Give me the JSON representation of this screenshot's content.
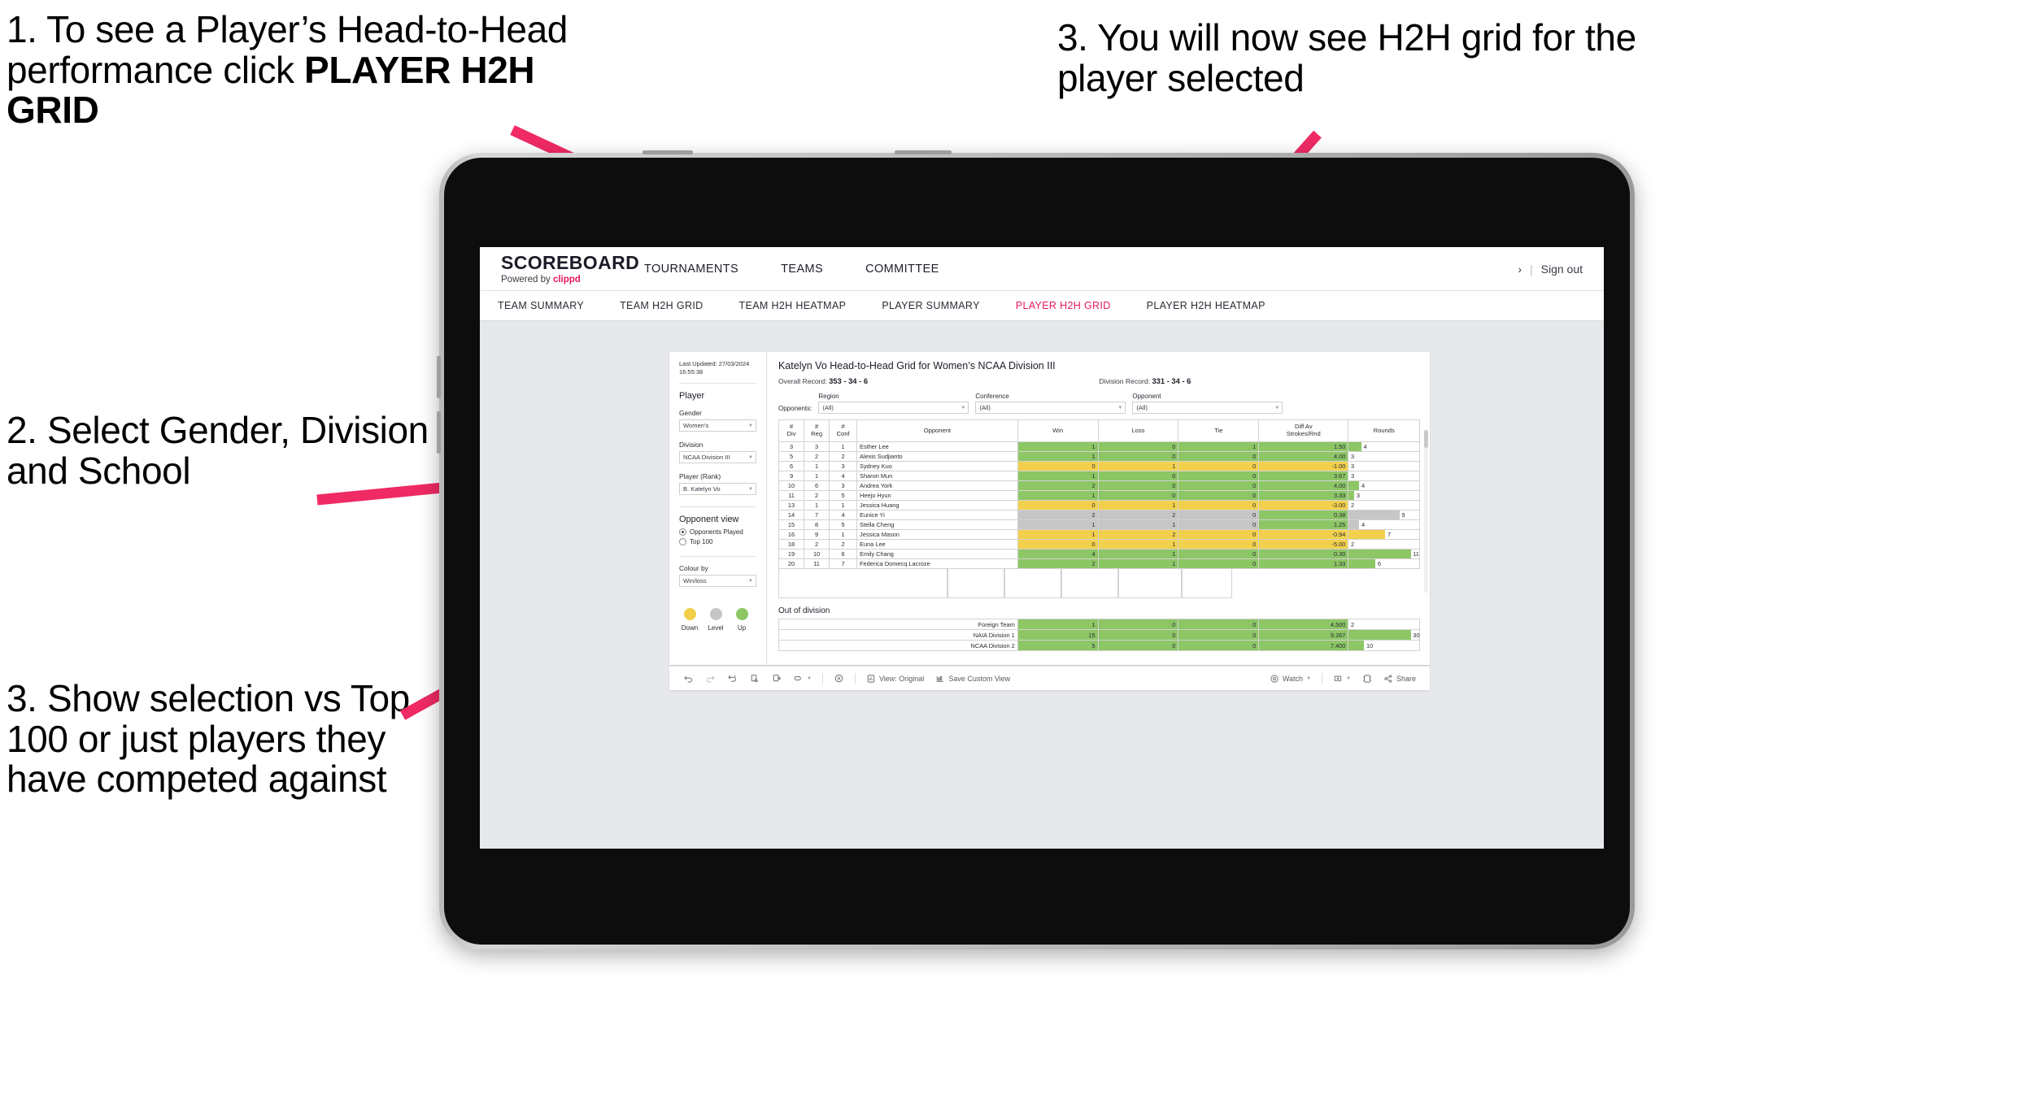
{
  "annotations": [
    {
      "id": "1",
      "text_plain": "1. To see a Player’s Head-to-Head performance click ",
      "text_bold": "PLAYER H2H GRID"
    },
    {
      "id": "2",
      "text": "2. Select Gender, Division and School"
    },
    {
      "id": "3",
      "text": "3. Show selection vs Top 100 or just players they have competed against"
    },
    {
      "id": "4",
      "text": "3. You will now see H2H grid for the player selected"
    }
  ],
  "colors": {
    "accent_pink": "#e8185d",
    "arrow_pink": "#ef2a64",
    "win_green": "#8cc665",
    "loss_yellow": "#f2d04b",
    "level_grey": "#c6c6c6",
    "canvas_grey": "#e6e8ec"
  },
  "app": {
    "brand": {
      "title": "SCOREBOARD",
      "powered_prefix": "Powered by ",
      "powered_brand": "clippd"
    },
    "top_nav": [
      {
        "label": "TOURNAMENTS"
      },
      {
        "label": "TEAMS"
      },
      {
        "label": "COMMITTEE"
      }
    ],
    "account": {
      "arrow": "›",
      "separator": "|",
      "sign_out": "Sign out"
    },
    "sub_nav": [
      {
        "label": "TEAM SUMMARY",
        "active": false
      },
      {
        "label": "TEAM H2H GRID",
        "active": false
      },
      {
        "label": "TEAM H2H HEATMAP",
        "active": false
      },
      {
        "label": "PLAYER SUMMARY",
        "active": false
      },
      {
        "label": "PLAYER H2H GRID",
        "active": true
      },
      {
        "label": "PLAYER H2H HEATMAP",
        "active": false
      }
    ]
  },
  "pane": {
    "last_updated": "Last Updated: 27/03/2024 16:55:38",
    "player_section_title": "Player",
    "fields": [
      {
        "label": "Gender",
        "value": "Women's"
      },
      {
        "label": "Division",
        "value": "NCAA Division III"
      },
      {
        "label": "Player (Rank)",
        "value": "B. Katelyn Vo"
      }
    ],
    "opponent_view": {
      "title": "Opponent view",
      "options": [
        {
          "label": "Opponents Played",
          "selected": true
        },
        {
          "label": "Top 100",
          "selected": false
        }
      ]
    },
    "colour_by": {
      "label": "Colour by",
      "value": "Win/loss"
    },
    "legend": [
      {
        "label": "Down",
        "color": "#f2d04b"
      },
      {
        "label": "Level",
        "color": "#c6c6c6"
      },
      {
        "label": "Up",
        "color": "#8cc665"
      }
    ]
  },
  "viz": {
    "title": "Katelyn Vo Head-to-Head Grid for Women’s NCAA Division III",
    "overall_record_label": "Overall Record: ",
    "overall_record_value": "353 -  34 - 6",
    "division_record_label": "Division Record: ",
    "division_record_value": "331 -  34 - 6",
    "opponents_label": "Opponents:",
    "opponent_filters": [
      {
        "label": "Region",
        "value": "(All)"
      },
      {
        "label": "Conference",
        "value": "(All)"
      },
      {
        "label": "Opponent",
        "value": "(All)"
      }
    ]
  },
  "chart_data": {
    "type": "table",
    "title": "Katelyn Vo Head-to-Head Grid for Women’s NCAA Division III",
    "columns": [
      "# Div",
      "# Reg",
      "# Conf",
      "Opponent",
      "Win",
      "Loss",
      "Tie",
      "Diff Av Strokes/Rnd",
      "Rounds"
    ],
    "column_lines": [
      [
        "#",
        "Div"
      ],
      [
        "#",
        "Reg"
      ],
      [
        "#",
        "Conf"
      ],
      [
        "Opponent"
      ],
      [
        "Win"
      ],
      [
        "Loss"
      ],
      [
        "Tie"
      ],
      [
        "Diff Av",
        "Strokes/Rnd"
      ],
      [
        "Rounds"
      ]
    ],
    "rows": [
      {
        "div": "3",
        "reg": "3",
        "conf": "1",
        "opponent": "Esther Lee",
        "win": "1",
        "loss": "0",
        "tie": "1",
        "diff": "1.50",
        "rounds": "4",
        "state": "up",
        "rounds_pct": 18
      },
      {
        "div": "5",
        "reg": "2",
        "conf": "2",
        "opponent": "Alexis Sudjianto",
        "win": "1",
        "loss": "0",
        "tie": "0",
        "diff": "4.00",
        "rounds": "3",
        "state": "up",
        "rounds_pct": 0
      },
      {
        "div": "6",
        "reg": "1",
        "conf": "3",
        "opponent": "Sydney Kuo",
        "win": "0",
        "loss": "1",
        "tie": "0",
        "diff": "-1.00",
        "rounds": "3",
        "state": "down",
        "rounds_pct": 0
      },
      {
        "div": "9",
        "reg": "1",
        "conf": "4",
        "opponent": "Sharon Mun",
        "win": "1",
        "loss": "0",
        "tie": "0",
        "diff": "3.67",
        "rounds": "3",
        "state": "up",
        "rounds_pct": 0
      },
      {
        "div": "10",
        "reg": "6",
        "conf": "3",
        "opponent": "Andrea York",
        "win": "2",
        "loss": "0",
        "tie": "0",
        "diff": "4.00",
        "rounds": "4",
        "state": "up",
        "rounds_pct": 15
      },
      {
        "div": "11",
        "reg": "2",
        "conf": "5",
        "opponent": "Heejo Hyun",
        "win": "1",
        "loss": "0",
        "tie": "0",
        "diff": "3.33",
        "rounds": "3",
        "state": "up",
        "rounds_pct": 8
      },
      {
        "div": "13",
        "reg": "1",
        "conf": "1",
        "opponent": "Jessica Huang",
        "win": "0",
        "loss": "1",
        "tie": "0",
        "diff": "-3.00",
        "rounds": "2",
        "state": "down",
        "rounds_pct": 0
      },
      {
        "div": "14",
        "reg": "7",
        "conf": "4",
        "opponent": "Eunice Yi",
        "win": "2",
        "loss": "2",
        "tie": "0",
        "diff": "0.38",
        "rounds": "9",
        "state": "level",
        "rounds_pct": 72
      },
      {
        "div": "15",
        "reg": "8",
        "conf": "5",
        "opponent": "Stella Cheng",
        "win": "1",
        "loss": "1",
        "tie": "0",
        "diff": "1.25",
        "rounds": "4",
        "state": "level",
        "rounds_pct": 15
      },
      {
        "div": "16",
        "reg": "9",
        "conf": "1",
        "opponent": "Jessica Mason",
        "win": "1",
        "loss": "2",
        "tie": "0",
        "diff": "-0.94",
        "rounds": "7",
        "state": "down",
        "rounds_pct": 52
      },
      {
        "div": "18",
        "reg": "2",
        "conf": "2",
        "opponent": "Euna Lee",
        "win": "0",
        "loss": "1",
        "tie": "0",
        "diff": "-5.00",
        "rounds": "2",
        "state": "down",
        "rounds_pct": 0
      },
      {
        "div": "19",
        "reg": "10",
        "conf": "6",
        "opponent": "Emily Chang",
        "win": "4",
        "loss": "1",
        "tie": "0",
        "diff": "0.30",
        "rounds": "11",
        "state": "up",
        "rounds_pct": 88
      },
      {
        "div": "20",
        "reg": "11",
        "conf": "7",
        "opponent": "Federica Domecq Lacroze",
        "win": "2",
        "loss": "1",
        "tie": "0",
        "diff": "1.33",
        "rounds": "6",
        "state": "up",
        "rounds_pct": 38
      }
    ],
    "out_of_division": {
      "title": "Out of division",
      "rows": [
        {
          "name": "Foreign Team",
          "win": "1",
          "loss": "0",
          "tie": "0",
          "diff": "4.500",
          "rounds": "2",
          "state": "up",
          "rounds_pct": 0
        },
        {
          "name": "NAIA Division 1",
          "win": "15",
          "loss": "0",
          "tie": "0",
          "diff": "9.267",
          "rounds": "30",
          "state": "up",
          "rounds_pct": 88
        },
        {
          "name": "NCAA Division 2",
          "win": "5",
          "loss": "0",
          "tie": "0",
          "diff": "7.400",
          "rounds": "10",
          "state": "up",
          "rounds_pct": 22
        }
      ]
    }
  },
  "toolbar": {
    "view_label": "View: Original",
    "save_label": "Save Custom View",
    "watch_label": "Watch",
    "share_label": "Share"
  }
}
